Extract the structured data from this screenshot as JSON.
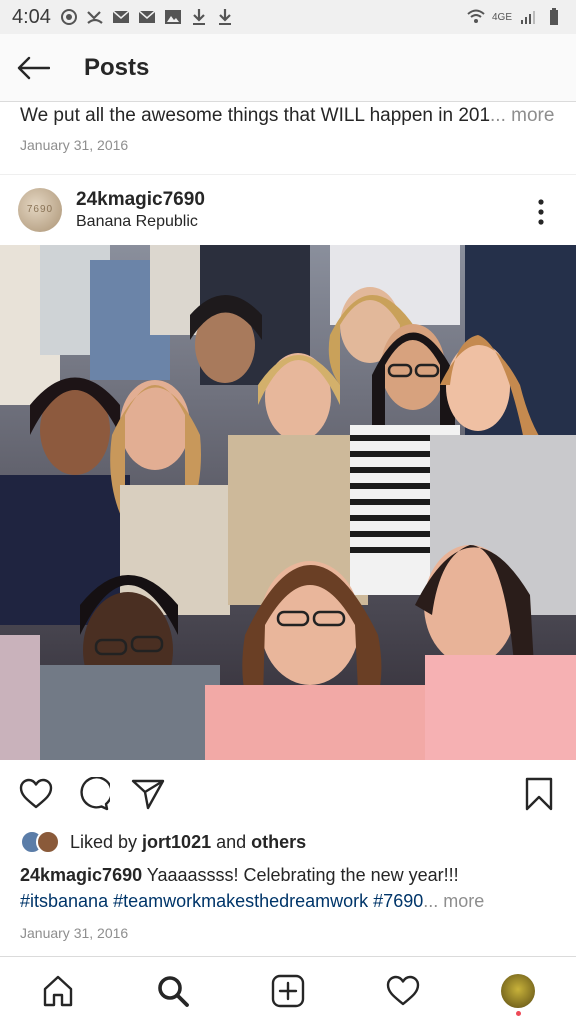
{
  "status_bar": {
    "time": "4:04",
    "network": "4GE",
    "icons": [
      "whatsapp-icon",
      "missed-call-icon",
      "mail-icon",
      "mail-icon",
      "image-icon",
      "download-icon",
      "download-icon",
      "wifi-icon",
      "signal-icon",
      "battery-icon"
    ]
  },
  "app_bar": {
    "title": "Posts",
    "back_icon": "arrow-left-icon"
  },
  "previous_post": {
    "caption": "We put all the awesome things that WILL happen in 201",
    "more_label": "... more",
    "date": "January 31, 2016"
  },
  "post": {
    "avatar_text": "7690",
    "username": "24kmagic7690",
    "location": "Banana Republic",
    "menu_icon": "more-vertical-icon",
    "photo": {
      "description": "group-selfie",
      "colors": {
        "background": "#3b3138",
        "accent": "#f2a9a6"
      }
    },
    "actions": [
      "heart-icon",
      "comment-icon",
      "share-icon",
      "bookmark-icon"
    ],
    "likes": {
      "prefix": "Liked by ",
      "user": "jort1021",
      "middle": " and ",
      "others": "others"
    },
    "caption_user": "24kmagic7690",
    "caption_text": " Yaaaassss! Celebrating the new year!!!",
    "hashtags": "#itsbanana #teamworkmakesthedreamwork #7690",
    "more_label": "... more",
    "date": "January 31, 2016"
  },
  "bottom_nav": {
    "items": [
      "home-icon",
      "search-icon",
      "add-post-icon",
      "activity-heart-icon",
      "profile-avatar"
    ]
  },
  "colors": {
    "text": "#262626",
    "muted": "#8e8e8e",
    "hashtag": "#003569",
    "divider": "#dbdbdb",
    "notification_dot": "#ed4956"
  }
}
